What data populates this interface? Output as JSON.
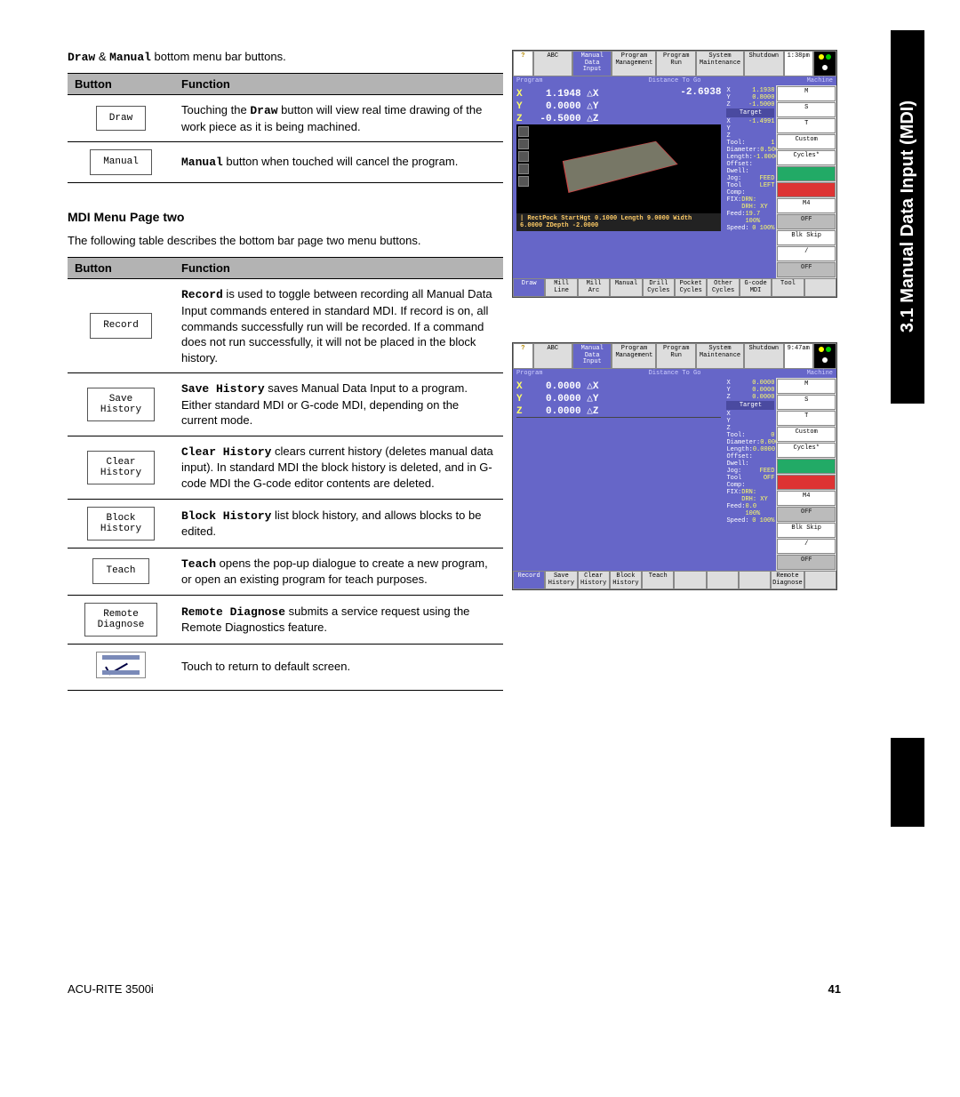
{
  "intro": {
    "btn1": "Draw",
    "amp": " & ",
    "btn2": "Manual",
    "rest": " bottom menu bar buttons."
  },
  "table1": {
    "hdr_button": "Button",
    "hdr_function": "Function",
    "rows": [
      {
        "btn": "Draw",
        "func_pre": "Touching the ",
        "func_bold": "Draw",
        "func_post": " button will view real time drawing of the work piece as it is being machined."
      },
      {
        "btn": "Manual",
        "func_bold": "Manual",
        "func_post": " button when touched will cancel the program."
      }
    ]
  },
  "subhead2": "MDI Menu Page two",
  "para2": "The following table describes the bottom bar page two menu buttons.",
  "table2": {
    "hdr_button": "Button",
    "hdr_function": "Function",
    "rows": [
      {
        "btn": "Record",
        "func_bold": "Record",
        "func_post": " is used to toggle between recording all Manual Data Input commands entered in standard MDI.  If record is on, all commands successfully run will be recorded.  If a command does not run successfully, it will not be placed in the block history."
      },
      {
        "btn": "Save\nHistory",
        "func_bold": "Save History",
        "func_post": " saves Manual Data Input to a program. Either standard MDI or G-code MDI, depending on the current mode."
      },
      {
        "btn": "Clear\nHistory",
        "func_bold": "Clear History",
        "func_post": " clears current history (deletes manual data input). In standard MDI the block history is deleted, and in G-code MDI the G-code editor contents are deleted."
      },
      {
        "btn": "Block\nHistory",
        "func_bold": "Block History",
        "func_post": " list block history, and allows blocks to be edited."
      },
      {
        "btn": "Teach",
        "func_bold": "Teach",
        "func_post": " opens the pop-up dialogue to create a new program, or open an existing program for teach purposes."
      },
      {
        "btn": "Remote\nDiagnose",
        "func_bold": "Remote Diagnose",
        "func_post": " submits a service request using the Remote Diagnostics feature."
      },
      {
        "btn": "__return__",
        "func_post": "Touch to return to default screen."
      }
    ]
  },
  "sidetab": "3.1 Manual Data Input (MDI)",
  "footer": {
    "left": "ACU-RITE 3500i",
    "right": "41"
  },
  "cnc1": {
    "topbar": {
      "help": "?",
      "abc": "ABC",
      "mdi_l1": "Manual Data",
      "mdi_l2": "Input",
      "pm_l1": "Program",
      "pm_l2": "Management",
      "pr": "Program Run",
      "sm_l1": "System",
      "sm_l2": "Maintenance",
      "sd": "Shutdown",
      "time": "1:38pm"
    },
    "band": {
      "left": "Program",
      "mid": "Distance To Go",
      "right": "Machine"
    },
    "dro": {
      "x_l": "X",
      "x_v": "1.1948",
      "x_a": "△X",
      "x_r": "-2.6938",
      "y_l": "Y",
      "y_v": "0.0000",
      "y_a": "△Y",
      "z_l": "Z",
      "z_v": "-0.5000",
      "z_a": "△Z"
    },
    "side_machine": {
      "x": {
        "l": "X",
        "v": "1.1938"
      },
      "y": {
        "l": "Y",
        "v": "0.8000"
      },
      "z": {
        "l": "Z",
        "v": "-1.5000"
      }
    },
    "side_target": {
      "hdr": "Target",
      "x": {
        "l": "X",
        "v": "-1.4991"
      },
      "y": {
        "l": "Y",
        "v": ""
      },
      "z": {
        "l": "Z",
        "v": ""
      }
    },
    "side_tool": {
      "tool": {
        "l": "Tool:",
        "v": "1"
      },
      "dia": {
        "l": "Diameter:",
        "v": "0.5000"
      },
      "len": {
        "l": "Length:",
        "v": "-1.0000"
      },
      "off": {
        "l": "Offset:",
        "v": ""
      },
      "dwell": {
        "l": "Dwell:",
        "v": ""
      },
      "jog": {
        "l": "Jog:",
        "v": "FEED"
      },
      "tc": {
        "l": "Tool Comp:",
        "v": "LEFT"
      },
      "fix": {
        "l": "FIX:",
        "v": "DRN: DRH: XY"
      },
      "feed": {
        "l": "Feed:",
        "v": "19.7 100%"
      },
      "speed": {
        "l": "Speed:",
        "v": "0 100%"
      }
    },
    "icons": {
      "m": "M",
      "s": "S",
      "t": "T",
      "custom": "Custom",
      "cycles": "Cycles*",
      "m4": "M4",
      "off1": "OFF",
      "blk": "Blk Skip",
      "slash": "/",
      "off2": "OFF"
    },
    "gline": "| RectPock StartHgt 0.1000 Length 9.0000 Width 6.0000 ZDepth -2.0000",
    "bbar": [
      "Draw",
      "Mill Line",
      "Mill Arc",
      "Manual",
      "Drill\nCycles",
      "Pocket\nCycles",
      "Other\nCycles",
      "G-code\nMDI",
      "Tool",
      ""
    ]
  },
  "cnc2": {
    "topbar": {
      "help": "?",
      "abc": "ABC",
      "mdi_l1": "Manual Data",
      "mdi_l2": "Input",
      "pm_l1": "Program",
      "pm_l2": "Management",
      "pr": "Program Run",
      "sm_l1": "System",
      "sm_l2": "Maintenance",
      "sd": "Shutdown",
      "time": "9:47am"
    },
    "band": {
      "left": "Program",
      "mid": "Distance To Go",
      "right": "Machine"
    },
    "dro": {
      "x_l": "X",
      "x_v": "0.0000",
      "x_a": "△X",
      "y_l": "Y",
      "y_v": "0.0000",
      "y_a": "△Y",
      "z_l": "Z",
      "z_v": "0.0000",
      "z_a": "△Z"
    },
    "side_machine": {
      "x": {
        "l": "X",
        "v": "0.0000"
      },
      "y": {
        "l": "Y",
        "v": "0.0000"
      },
      "z": {
        "l": "Z",
        "v": "0.0000"
      }
    },
    "side_target": {
      "hdr": "Target",
      "x": {
        "l": "X",
        "v": ""
      },
      "y": {
        "l": "Y",
        "v": ""
      },
      "z": {
        "l": "Z",
        "v": ""
      }
    },
    "side_tool": {
      "tool": {
        "l": "Tool:",
        "v": "0"
      },
      "dia": {
        "l": "Diameter:",
        "v": "0.0000"
      },
      "len": {
        "l": "Length:",
        "v": "0.0000"
      },
      "off": {
        "l": "Offset:",
        "v": ""
      },
      "dwell": {
        "l": "Dwell:",
        "v": ""
      },
      "jog": {
        "l": "Jog:",
        "v": "FEED"
      },
      "tc": {
        "l": "Tool Comp:",
        "v": "OFF"
      },
      "fix": {
        "l": "FIX:",
        "v": "DRN: DRH: XY"
      },
      "feed": {
        "l": "Feed:",
        "v": "0.0 100%"
      },
      "speed": {
        "l": "Speed:",
        "v": "0 100%"
      }
    },
    "icons": {
      "m": "M",
      "s": "S",
      "t": "T",
      "custom": "Custom",
      "cycles": "Cycles*",
      "m4": "M4",
      "off1": "OFF",
      "blk": "Blk Skip",
      "slash": "/",
      "off2": "OFF"
    },
    "bbar": [
      "Record",
      "Save\nHistory",
      "Clear\nHistory",
      "Block\nHistory",
      "Teach",
      "",
      "",
      "",
      "Remote\nDiagnose",
      ""
    ]
  }
}
